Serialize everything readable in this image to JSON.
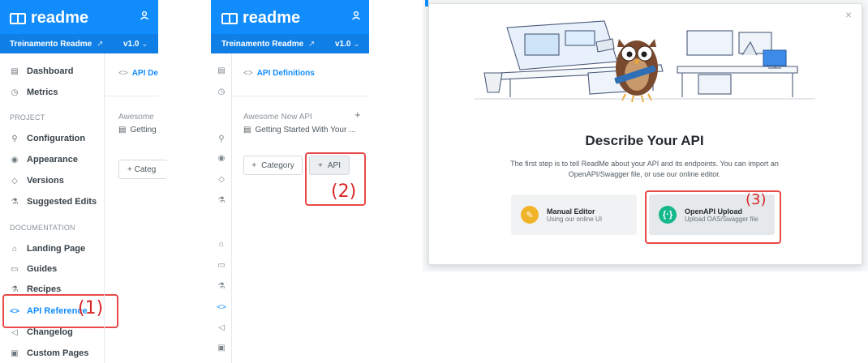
{
  "colors": {
    "brand": "#118cfd",
    "highlight": "#e84a4a",
    "manual": "#f0b429",
    "openapi": "#14b88a"
  },
  "panel1": {
    "logo": "readme",
    "project": "Treinamento Readme",
    "project_link": "↗",
    "version": "v1.0",
    "version_caret": "⌄",
    "nav_top": [
      {
        "label": "Dashboard",
        "icon": "dashboard-icon"
      },
      {
        "label": "Metrics",
        "icon": "clock-icon"
      }
    ],
    "section_project": "PROJECT",
    "nav_project": [
      {
        "label": "Configuration",
        "icon": "wrench-icon"
      },
      {
        "label": "Appearance",
        "icon": "eye-icon"
      },
      {
        "label": "Versions",
        "icon": "tag-icon"
      },
      {
        "label": "Suggested Edits",
        "icon": "flask-edit-icon"
      }
    ],
    "section_docs": "DOCUMENTATION",
    "nav_docs": [
      {
        "label": "Landing Page",
        "icon": "home-icon"
      },
      {
        "label": "Guides",
        "icon": "book-icon"
      },
      {
        "label": "Recipes",
        "icon": "flask-icon"
      },
      {
        "label": "API Reference",
        "icon": "code-icon"
      },
      {
        "label": "Changelog",
        "icon": "megaphone-icon"
      },
      {
        "label": "Custom Pages",
        "icon": "page-icon"
      }
    ],
    "content_head": "API De",
    "content_api": "Awesome",
    "content_doc": "Getting",
    "content_btn": "+ Categ",
    "callout": "(1)"
  },
  "panel2": {
    "logo": "readme",
    "project": "Treinamento Readme",
    "project_link": "↗",
    "version": "v1.0",
    "version_caret": "⌄",
    "header": "API Definitions",
    "api_name": "Awesome New API",
    "doc_title": "Getting Started With Your ...",
    "btn_category": "Category",
    "btn_api": "API",
    "callout": "(2)"
  },
  "panel3": {
    "close": "×",
    "title": "Describe Your API",
    "desc_line1": "The first step is to tell ReadMe about your API and its endpoints. You can import an",
    "desc_line2": "OpenAPI/Swagger file, or use our online editor.",
    "options": [
      {
        "title": "Manual Editor",
        "subtitle": "Using our online UI"
      },
      {
        "title": "OpenAPI Upload",
        "subtitle": "Upload OAS/Swagger file"
      }
    ],
    "callout": "(3)"
  }
}
